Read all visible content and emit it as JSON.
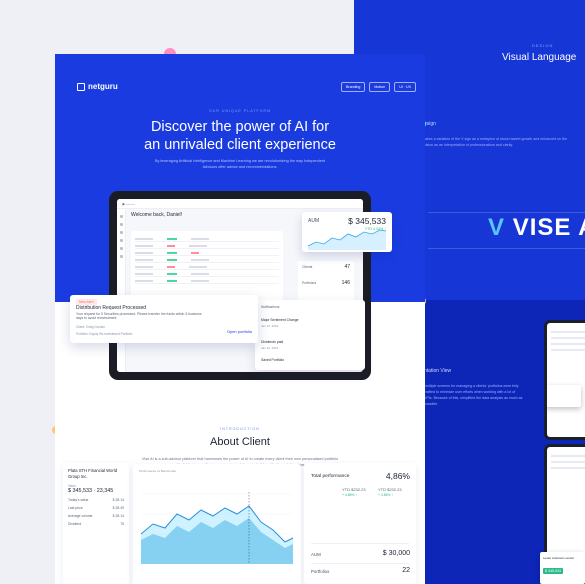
{
  "brand": {
    "logo_text": "netguru"
  },
  "nav": {
    "pills": [
      "Branding",
      "Motion",
      "UI · UX"
    ]
  },
  "hero": {
    "kicker": "OUR UNIQUE PLATFORM",
    "title_line1": "Discover the power of AI for",
    "title_line2": "an unrivaled client experience",
    "subtitle": "By leveraging Artificial Intelligence and Machine Learning we are revolutionizing the way Independent Advisors offer advice and recommendations."
  },
  "tablet": {
    "welcome": "Welcome back, Daniel!",
    "aum_label": "AUM",
    "aum_value": "$ 345,533",
    "aum_change": "YTD 4.34% ↑",
    "side_labels": [
      "Clients",
      "Portfolios"
    ],
    "side_values": [
      "47",
      "146"
    ]
  },
  "distribution": {
    "tag": "New Alert",
    "title": "Distribution Request Processed",
    "body": "Your request for 5 Securities processed. Please transfer the funds within 3 business days to avoid reinvestment.",
    "link1": "Client: Craig Gordon",
    "link2": "Portfolio: Equity Re-investment Portfolio",
    "button": "Open portfolio"
  },
  "notifications": {
    "header": "Notifications",
    "items": [
      {
        "title": "Major Sentiment Change",
        "sub": "Jan 12, 2019"
      },
      {
        "title": "Dividends paid",
        "sub": "Jan 10, 2019"
      },
      {
        "title": "Saved Portfolio",
        "sub": "Jan 08, 2019"
      }
    ]
  },
  "about": {
    "kicker": "INTRODUCTION",
    "title": "About Client",
    "subtitle": "Vise AI is a sub-advisor platform that harnesses the power of AI to create every client their own personalized portfolio of individual securities - empowering advisors to build and better relationships."
  },
  "client_panel": {
    "name": "Plata STH Financial World Group Inc.",
    "metric_label": "Value",
    "metric": "$ 345,533 · 23,345",
    "rows": [
      {
        "k": "Today's value",
        "v": "$ 28.14"
      },
      {
        "k": "Last price",
        "v": "$ 28.49"
      },
      {
        "k": "Average volume",
        "v": "$ 28.14"
      },
      {
        "k": "Dividend",
        "v": "75"
      }
    ]
  },
  "chart_panel": {
    "title": "Performance vs Benchmark"
  },
  "performance_panel": {
    "label": "Total performance",
    "value": "4,86%",
    "ytd_a": "YTD $232.23",
    "ytd_a_pct": "+ 4.86% ↑",
    "ytd_b": "YTD $232.23",
    "ytd_b_pct": "+ 4.86% ↑",
    "aum_label": "AUM",
    "aum_value": "$ 30,000",
    "portfolios_label": "Portfolios",
    "portfolios_value": "22"
  },
  "right_panel": {
    "kicker": "DESIGN",
    "title": "Visual Language",
    "design_label": "esign",
    "design_text": "takes a variation of the V sign as a metaphor of stock market growth and enhanced on the vision as an interpretation of professionalism and clarity.",
    "brand_word": "VISE A",
    "nav_label": "ntation View",
    "nav_text": "multiple screens for managing a clients' portfolios were fully crafted to minimize user efforts when working with a lot of KPIs. Because of this, simplified the data analysis as much as possible.",
    "mini_name": "Lester Anderson-center",
    "mini_value": "$ 345,533"
  },
  "colors": {
    "hero_blue": "#1a3be0",
    "panel_blue": "#1636d6",
    "accent_green": "#2bb98a",
    "alert_red": "#ff6d6d"
  }
}
